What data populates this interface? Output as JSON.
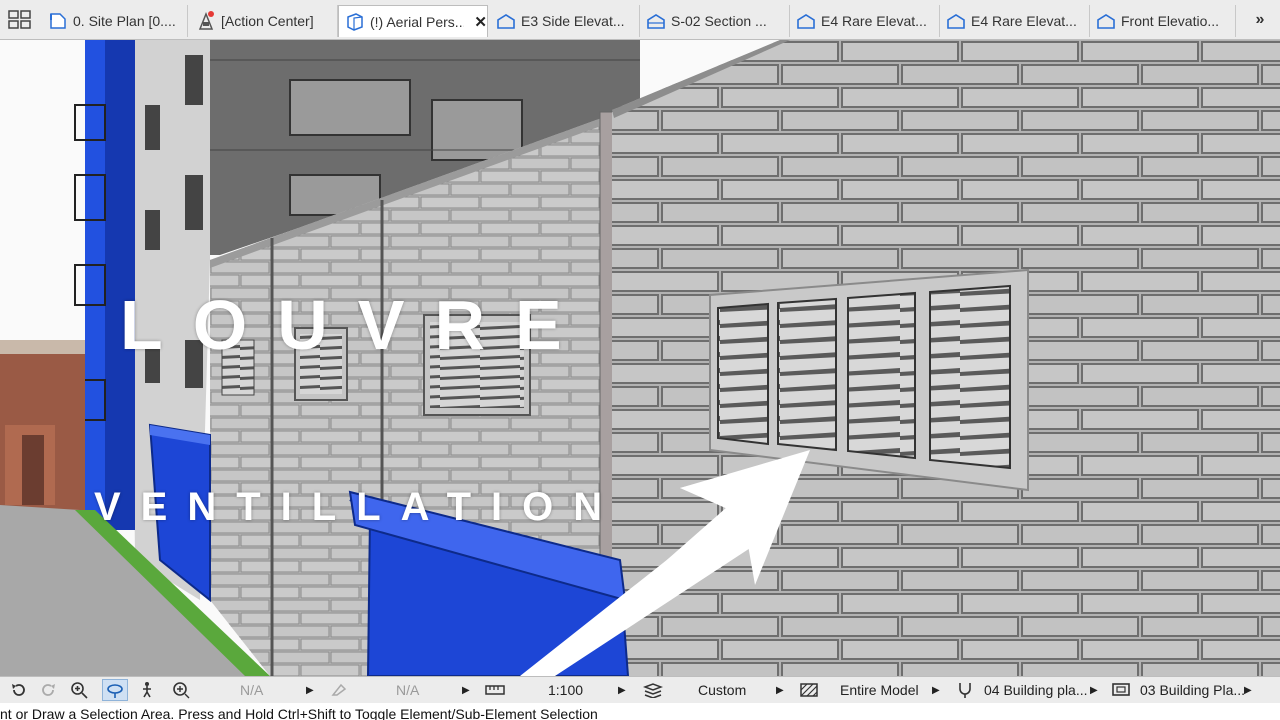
{
  "tabs": [
    {
      "label": "0. Site Plan [0....",
      "icon": "floor-plan-icon",
      "active": false
    },
    {
      "label": "[Action Center]",
      "icon": "action-center-icon",
      "active": false
    },
    {
      "label": "(!) Aerial Pers...",
      "icon": "3d-view-icon",
      "active": true
    },
    {
      "label": "E3 Side Elevat...",
      "icon": "elevation-icon",
      "active": false
    },
    {
      "label": "S-02 Section ...",
      "icon": "section-icon",
      "active": false
    },
    {
      "label": "E4 Rare Elevat...",
      "icon": "elevation-icon",
      "active": false
    },
    {
      "label": "E4 Rare Elevat...",
      "icon": "elevation-icon",
      "active": false
    },
    {
      "label": "Front Elevatio...",
      "icon": "elevation-icon",
      "active": false
    }
  ],
  "close_glyph": "✕",
  "more_glyph": "»",
  "overlay": {
    "title": "LOUVRE",
    "subtitle": "VENTILLATION"
  },
  "status": {
    "na1": "N/A",
    "na2": "N/A",
    "scale": "1:100",
    "pen_set": "Custom",
    "model_view": "Entire Model",
    "layer_combo": "04 Building pla...",
    "dimension": "03 Building Pla..."
  },
  "hint": "nt or Draw a Selection Area. Press and Hold Ctrl+Shift to Toggle Element/Sub-Element Selection",
  "colors": {
    "accent": "#2459e6",
    "tab_icon": "#2a6fd6",
    "notification": "#e53935"
  }
}
